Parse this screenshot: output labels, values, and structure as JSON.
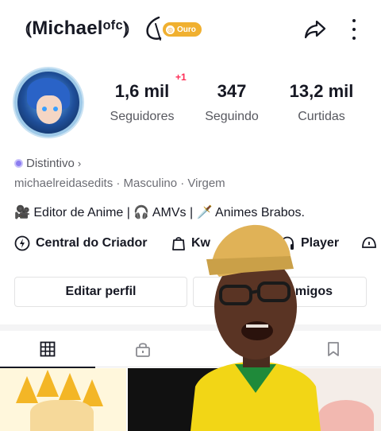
{
  "header": {
    "username": "⦅Michaelᵒᶠᶜ⦆",
    "badge_label": "Ouro",
    "icons": [
      "share-icon",
      "more-icon"
    ]
  },
  "stats": {
    "new_followers_badge": "+1",
    "followers": {
      "value": "1,6 mil",
      "label": "Seguidores"
    },
    "following": {
      "value": "347",
      "label": "Seguindo"
    },
    "likes": {
      "value": "13,2 mil",
      "label": "Curtidas"
    }
  },
  "profile": {
    "distintivo": "Distintivo",
    "info_line": "michaelreidasedits · Masculino · Virgem",
    "bio": "🎥 Editor de Anime | 🎧 AMVs | 🗡️ Animes Brabos."
  },
  "links": {
    "creator_center": "Central do Criador",
    "kw": "Kw",
    "player": "Player"
  },
  "buttons": {
    "edit_profile": "Editar perfil",
    "friends": "amigos"
  },
  "tabs": [
    "videos-grid-tab",
    "private-tab",
    "reposts-tab",
    "saved-tab"
  ],
  "colors": {
    "text": "#161823",
    "secondary": "#57585f",
    "accent_red": "#fe2c55",
    "gold_badge": "#f0b030",
    "border": "#e3e3e4"
  }
}
